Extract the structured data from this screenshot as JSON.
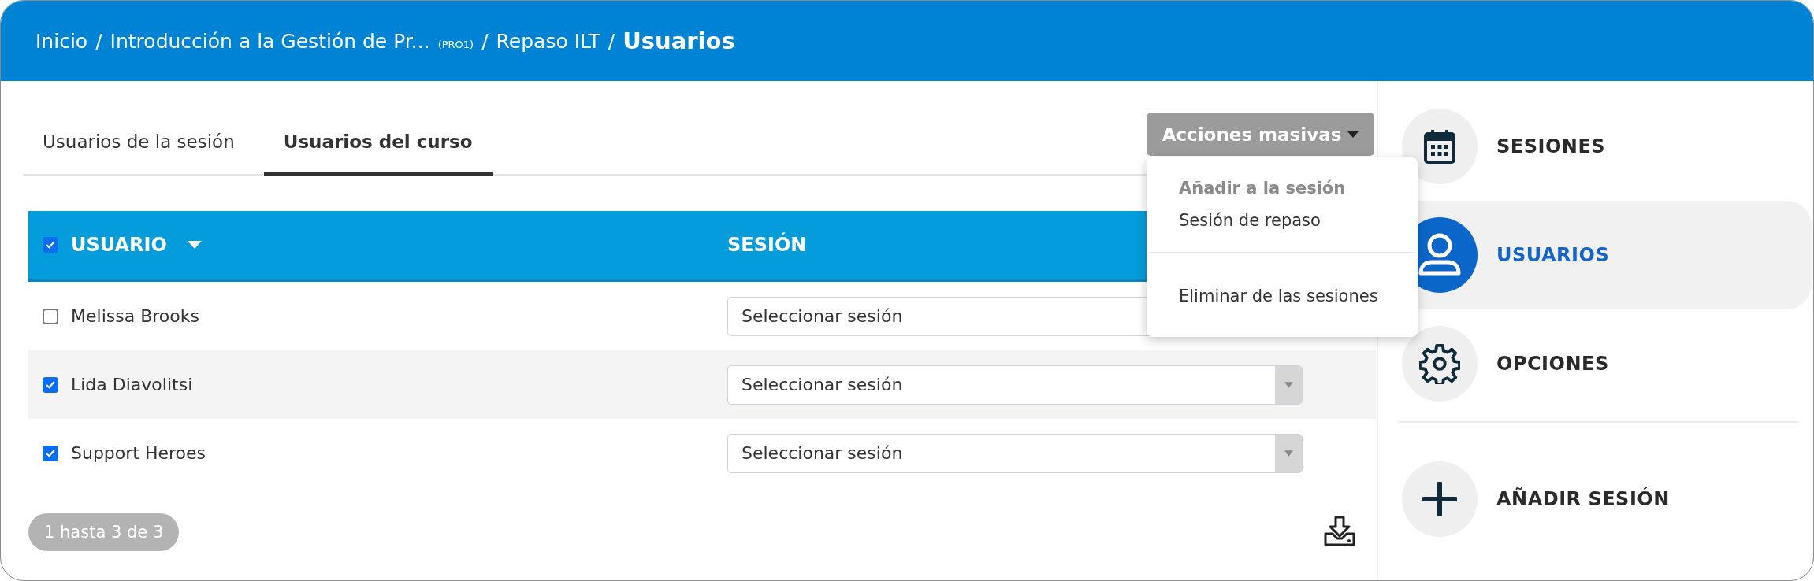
{
  "breadcrumb": {
    "separator": "/",
    "items": [
      {
        "text": "Inicio"
      },
      {
        "text": "Introducción a la Gestión de Pr...",
        "code": "(PRO1)"
      },
      {
        "text": "Repaso ILT"
      }
    ],
    "current": "Usuarios"
  },
  "tabs": [
    {
      "label": "Usuarios de la sesión",
      "selected": false
    },
    {
      "label": "Usuarios del curso",
      "selected": true
    }
  ],
  "bulk_actions": {
    "label": "Acciones masivas",
    "expanded": true,
    "menu": [
      {
        "kind": "header",
        "text": "Añadir a la sesión"
      },
      {
        "kind": "item",
        "text": "Sesión de repaso"
      },
      {
        "kind": "divider"
      },
      {
        "kind": "item",
        "text": "Eliminar de las sesiones"
      }
    ]
  },
  "table": {
    "select_all": {
      "checked": true
    },
    "columns": [
      {
        "label": "USUARIO",
        "sorted": true
      },
      {
        "label": "SESIÓN"
      }
    ],
    "rows": [
      {
        "name": "Melissa Brooks",
        "checked": false,
        "session": {
          "placeholder": "Seleccionar sesión"
        }
      },
      {
        "name": "Lida Diavolitsi",
        "checked": true,
        "session": {
          "placeholder": "Seleccionar sesión"
        }
      },
      {
        "name": "Support Heroes",
        "checked": true,
        "session": {
          "placeholder": "Seleccionar sesión"
        }
      }
    ]
  },
  "pagination": "1 hasta 3 de 3",
  "sidebar": {
    "items": [
      {
        "label": "SESIONES",
        "selected": false
      },
      {
        "label": "USUARIOS",
        "selected": true
      },
      {
        "label": "OPCIONES",
        "selected": false
      }
    ],
    "add_action": {
      "label": "AÑADIR SESIÓN"
    }
  }
}
